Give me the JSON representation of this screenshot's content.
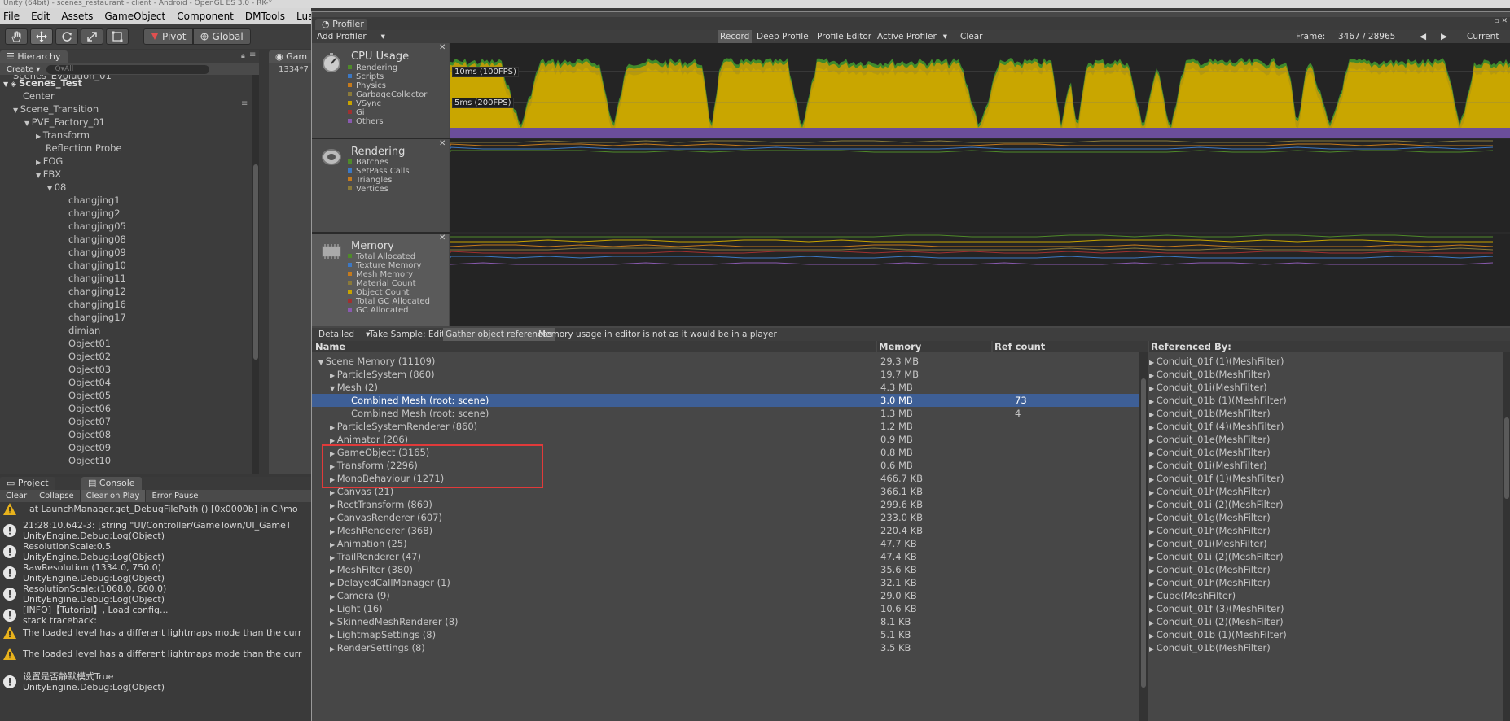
{
  "titlebar": "Unity (64bit) - scenes_restaurant - client - Android - OpenGL ES 3.0 - RK-*",
  "menu": [
    "File",
    "Edit",
    "Assets",
    "GameObject",
    "Component",
    "DMTools",
    "Lua"
  ],
  "toolbar": {
    "tools": [
      "hand-icon",
      "move-icon",
      "rotate-icon",
      "scale-icon",
      "rect-icon"
    ],
    "pivot_label": "Pivot",
    "global_label": "Global"
  },
  "hierarchy": {
    "tab_label": "Hierarchy",
    "create_label": "Create ▾",
    "search_placeholder": "Q▾All",
    "rows": [
      {
        "text": "Scenes_Evolution_01",
        "indent": 16,
        "arrow": ""
      },
      {
        "text": "Scenes_Test",
        "indent": 16,
        "arrow": "▼",
        "bold": true
      },
      {
        "text": "Center",
        "indent": 28,
        "arrow": ""
      },
      {
        "text": "Scene_Transition",
        "indent": 28,
        "arrow": "▼"
      },
      {
        "text": "PVE_Factory_01",
        "indent": 42,
        "arrow": "▼"
      },
      {
        "text": "Transform",
        "indent": 56,
        "arrow": "▶"
      },
      {
        "text": "Reflection Probe",
        "indent": 56,
        "arrow": ""
      },
      {
        "text": "FOG",
        "indent": 56,
        "arrow": "▶"
      },
      {
        "text": "FBX",
        "indent": 56,
        "arrow": "▼"
      },
      {
        "text": "08",
        "indent": 70,
        "arrow": "▼"
      },
      {
        "text": "changjing1",
        "indent": 84,
        "arrow": ""
      },
      {
        "text": "changjing2",
        "indent": 84,
        "arrow": ""
      },
      {
        "text": "changjing05",
        "indent": 84,
        "arrow": ""
      },
      {
        "text": "changjing08",
        "indent": 84,
        "arrow": ""
      },
      {
        "text": "changjing09",
        "indent": 84,
        "arrow": ""
      },
      {
        "text": "changjing10",
        "indent": 84,
        "arrow": ""
      },
      {
        "text": "changjing11",
        "indent": 84,
        "arrow": ""
      },
      {
        "text": "changjing12",
        "indent": 84,
        "arrow": ""
      },
      {
        "text": "changjing16",
        "indent": 84,
        "arrow": ""
      },
      {
        "text": "changjing17",
        "indent": 84,
        "arrow": ""
      },
      {
        "text": "dimian",
        "indent": 84,
        "arrow": ""
      },
      {
        "text": "Object01",
        "indent": 84,
        "arrow": ""
      },
      {
        "text": "Object02",
        "indent": 84,
        "arrow": ""
      },
      {
        "text": "Object03",
        "indent": 84,
        "arrow": ""
      },
      {
        "text": "Object04",
        "indent": 84,
        "arrow": ""
      },
      {
        "text": "Object05",
        "indent": 84,
        "arrow": ""
      },
      {
        "text": "Object06",
        "indent": 84,
        "arrow": ""
      },
      {
        "text": "Object07",
        "indent": 84,
        "arrow": ""
      },
      {
        "text": "Object08",
        "indent": 84,
        "arrow": ""
      },
      {
        "text": "Object09",
        "indent": 84,
        "arrow": ""
      },
      {
        "text": "Object10",
        "indent": 84,
        "arrow": ""
      }
    ]
  },
  "game": {
    "tab_label": "Gam",
    "resolution": "1334*7"
  },
  "console": {
    "project_tab": "Project",
    "console_tab": "Console",
    "buttons": [
      "Clear",
      "Collapse",
      "Clear on Play",
      "Error Pause"
    ],
    "messages": [
      {
        "type": "warn",
        "lines": [
          "at LaunchManager.get_DebugFilePath () [0x0000b] in C:\\mo"
        ]
      },
      {
        "type": "info",
        "lines": [
          "21:28:10.642-3: [string \"UI/Controller/GameTown/UI_GameT",
          "UnityEngine.Debug:Log(Object)"
        ]
      },
      {
        "type": "info",
        "lines": [
          "ResolutionScale:0.5",
          "UnityEngine.Debug:Log(Object)"
        ]
      },
      {
        "type": "info",
        "lines": [
          "RawResolution:(1334.0, 750.0)",
          "UnityEngine.Debug:Log(Object)"
        ]
      },
      {
        "type": "info",
        "lines": [
          "ResolutionScale:(1068.0, 600.0)",
          "UnityEngine.Debug:Log(Object)"
        ]
      },
      {
        "type": "info",
        "lines": [
          "[INFO]【Tutorial】, Load config...",
          "stack traceback:"
        ]
      },
      {
        "type": "warn",
        "lines": [
          "The loaded level has a different lightmaps mode than the curr"
        ]
      },
      {
        "type": "warn",
        "lines": [
          "The loaded level has a different lightmaps mode than the curr"
        ]
      },
      {
        "type": "info",
        "lines": [
          "设置是否静默模式True",
          "UnityEngine.Debug:Log(Object)"
        ]
      }
    ]
  },
  "profiler": {
    "tab_label": "Profiler",
    "add_profiler": "Add Profiler",
    "record": "Record",
    "deep_profile": "Deep Profile",
    "profile_editor": "Profile Editor",
    "active_profiler": "Active Profiler",
    "clear": "Clear",
    "frame_label": "Frame:",
    "frame_value": "3467 / 28965",
    "current": "Current",
    "cpu": {
      "title": "CPU Usage",
      "legend": [
        {
          "name": "Rendering",
          "color": "#4f8a2a"
        },
        {
          "name": "Scripts",
          "color": "#3c78c4"
        },
        {
          "name": "Physics",
          "color": "#c57a1c"
        },
        {
          "name": "GarbageCollector",
          "color": "#8a7a3a"
        },
        {
          "name": "VSync",
          "color": "#c8a400"
        },
        {
          "name": "Gi",
          "color": "#a03030"
        },
        {
          "name": "Others",
          "color": "#8a5ab0"
        }
      ],
      "label_100": "10ms (100FPS)",
      "label_200": "5ms (200FPS)"
    },
    "rendering": {
      "title": "Rendering",
      "legend": [
        {
          "name": "Batches",
          "color": "#4f8a2a"
        },
        {
          "name": "SetPass Calls",
          "color": "#3c78c4"
        },
        {
          "name": "Triangles",
          "color": "#c57a1c"
        },
        {
          "name": "Vertices",
          "color": "#8a7a3a"
        }
      ]
    },
    "memory": {
      "title": "Memory",
      "legend": [
        {
          "name": "Total Allocated",
          "color": "#4f8a2a"
        },
        {
          "name": "Texture Memory",
          "color": "#3c78c4"
        },
        {
          "name": "Mesh Memory",
          "color": "#c57a1c"
        },
        {
          "name": "Material Count",
          "color": "#8a7a3a"
        },
        {
          "name": "Object Count",
          "color": "#c8a400"
        },
        {
          "name": "Total GC Allocated",
          "color": "#a03030"
        },
        {
          "name": "GC Allocated",
          "color": "#8a5ab0"
        }
      ]
    },
    "detail": {
      "mode": "Detailed",
      "take_sample": "Take Sample: Editor",
      "gather": "Gather object references",
      "note": "Memory usage in editor is not as it would be in a player",
      "col_name": "Name",
      "col_memory": "Memory",
      "col_ref": "Ref count",
      "col_refby": "Referenced By:",
      "rows": [
        {
          "name": "Scene Memory (11109)",
          "indent": 0,
          "arrow": "▼",
          "mem": "29.3 MB",
          "ref": ""
        },
        {
          "name": "ParticleSystem (860)",
          "indent": 14,
          "arrow": "▶",
          "mem": "19.7 MB",
          "ref": ""
        },
        {
          "name": "Mesh (2)",
          "indent": 14,
          "arrow": "▼",
          "mem": "4.3 MB",
          "ref": ""
        },
        {
          "name": "Combined Mesh (root: scene)",
          "indent": 28,
          "arrow": "",
          "mem": "3.0 MB",
          "ref": "73",
          "sel": true
        },
        {
          "name": "Combined Mesh (root: scene)",
          "indent": 28,
          "arrow": "",
          "mem": "1.3 MB",
          "ref": "4"
        },
        {
          "name": "ParticleSystemRenderer (860)",
          "indent": 14,
          "arrow": "▶",
          "mem": "1.2 MB",
          "ref": ""
        },
        {
          "name": "Animator (206)",
          "indent": 14,
          "arrow": "▶",
          "mem": "0.9 MB",
          "ref": ""
        },
        {
          "name": "GameObject (3165)",
          "indent": 14,
          "arrow": "▶",
          "mem": "0.8 MB",
          "ref": ""
        },
        {
          "name": "Transform (2296)",
          "indent": 14,
          "arrow": "▶",
          "mem": "0.6 MB",
          "ref": ""
        },
        {
          "name": "MonoBehaviour (1271)",
          "indent": 14,
          "arrow": "▶",
          "mem": "466.7 KB",
          "ref": ""
        },
        {
          "name": "Canvas (21)",
          "indent": 14,
          "arrow": "▶",
          "mem": "366.1 KB",
          "ref": ""
        },
        {
          "name": "RectTransform (869)",
          "indent": 14,
          "arrow": "▶",
          "mem": "299.6 KB",
          "ref": ""
        },
        {
          "name": "CanvasRenderer (607)",
          "indent": 14,
          "arrow": "▶",
          "mem": "233.0 KB",
          "ref": ""
        },
        {
          "name": "MeshRenderer (368)",
          "indent": 14,
          "arrow": "▶",
          "mem": "220.4 KB",
          "ref": ""
        },
        {
          "name": "Animation (25)",
          "indent": 14,
          "arrow": "▶",
          "mem": "47.7 KB",
          "ref": ""
        },
        {
          "name": "TrailRenderer (47)",
          "indent": 14,
          "arrow": "▶",
          "mem": "47.4 KB",
          "ref": ""
        },
        {
          "name": "MeshFilter (380)",
          "indent": 14,
          "arrow": "▶",
          "mem": "35.6 KB",
          "ref": ""
        },
        {
          "name": "DelayedCallManager (1)",
          "indent": 14,
          "arrow": "▶",
          "mem": "32.1 KB",
          "ref": ""
        },
        {
          "name": "Camera (9)",
          "indent": 14,
          "arrow": "▶",
          "mem": "29.0 KB",
          "ref": ""
        },
        {
          "name": "Light (16)",
          "indent": 14,
          "arrow": "▶",
          "mem": "10.6 KB",
          "ref": ""
        },
        {
          "name": "SkinnedMeshRenderer (8)",
          "indent": 14,
          "arrow": "▶",
          "mem": "8.1 KB",
          "ref": ""
        },
        {
          "name": "LightmapSettings (8)",
          "indent": 14,
          "arrow": "▶",
          "mem": "5.1 KB",
          "ref": ""
        },
        {
          "name": "RenderSettings (8)",
          "indent": 14,
          "arrow": "▶",
          "mem": "3.5 KB",
          "ref": ""
        }
      ],
      "referenced_by": [
        "Conduit_01f (1)(MeshFilter)",
        "Conduit_01b(MeshFilter)",
        "Conduit_01i(MeshFilter)",
        "Conduit_01b (1)(MeshFilter)",
        "Conduit_01b(MeshFilter)",
        "Conduit_01f (4)(MeshFilter)",
        "Conduit_01e(MeshFilter)",
        "Conduit_01d(MeshFilter)",
        "Conduit_01i(MeshFilter)",
        "Conduit_01f (1)(MeshFilter)",
        "Conduit_01h(MeshFilter)",
        "Conduit_01i (2)(MeshFilter)",
        "Conduit_01g(MeshFilter)",
        "Conduit_01h(MeshFilter)",
        "Conduit_01i(MeshFilter)",
        "Conduit_01i (2)(MeshFilter)",
        "Conduit_01d(MeshFilter)",
        "Conduit_01h(MeshFilter)",
        "Cube(MeshFilter)",
        "Conduit_01f (3)(MeshFilter)",
        "Conduit_01i (2)(MeshFilter)",
        "Conduit_01b (1)(MeshFilter)",
        "Conduit_01b(MeshFilter)"
      ]
    }
  }
}
